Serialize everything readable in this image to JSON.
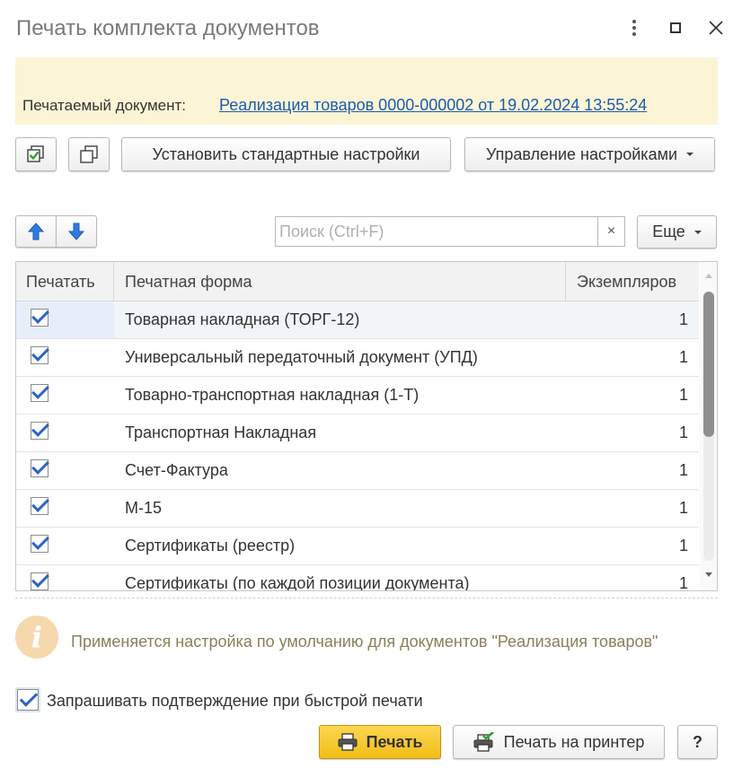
{
  "window": {
    "title": "Печать комплекта документов"
  },
  "document": {
    "label": "Печатаемый документ:",
    "link": "Реализация товаров 0000-000002 от 19.02.2024 13:55:24"
  },
  "toolbar": {
    "set_default_label": "Установить стандартные настройки",
    "manage_settings_label": "Управление настройками"
  },
  "list_toolbar": {
    "search_placeholder": "Поиск (Ctrl+F)",
    "clear_label": "×",
    "more_label": "Еще"
  },
  "table": {
    "columns": [
      "Печатать",
      "Печатная форма",
      "Экземпляров"
    ],
    "rows": [
      {
        "checked": true,
        "form": "Товарная накладная (ТОРГ-12)",
        "copies": "1"
      },
      {
        "checked": true,
        "form": "Универсальный передаточный документ (УПД)",
        "copies": "1"
      },
      {
        "checked": true,
        "form": "Товарно-транспортная накладная (1-Т)",
        "copies": "1"
      },
      {
        "checked": true,
        "form": "Транспортная Накладная",
        "copies": "1"
      },
      {
        "checked": true,
        "form": "Счет-Фактура",
        "copies": "1"
      },
      {
        "checked": true,
        "form": "М-15",
        "copies": "1"
      },
      {
        "checked": true,
        "form": "Сертификаты (реестр)",
        "copies": "1"
      },
      {
        "checked": true,
        "form": "Сертификаты (по каждой позиции документа)",
        "copies": "1"
      }
    ]
  },
  "info": {
    "text": "Применяется настройка по умолчанию для документов \"Реализация товаров\""
  },
  "confirm": {
    "checked": true,
    "label": "Запрашивать подтверждение при быстрой печати"
  },
  "footer": {
    "print_label": "Печать",
    "print_to_printer_label": "Печать на принтер",
    "help_label": "?"
  },
  "colors": {
    "info_panel": "#fbf5d6",
    "link": "#1d5bb0",
    "check": "#2c65c2",
    "print_button": "#f2bd17"
  }
}
